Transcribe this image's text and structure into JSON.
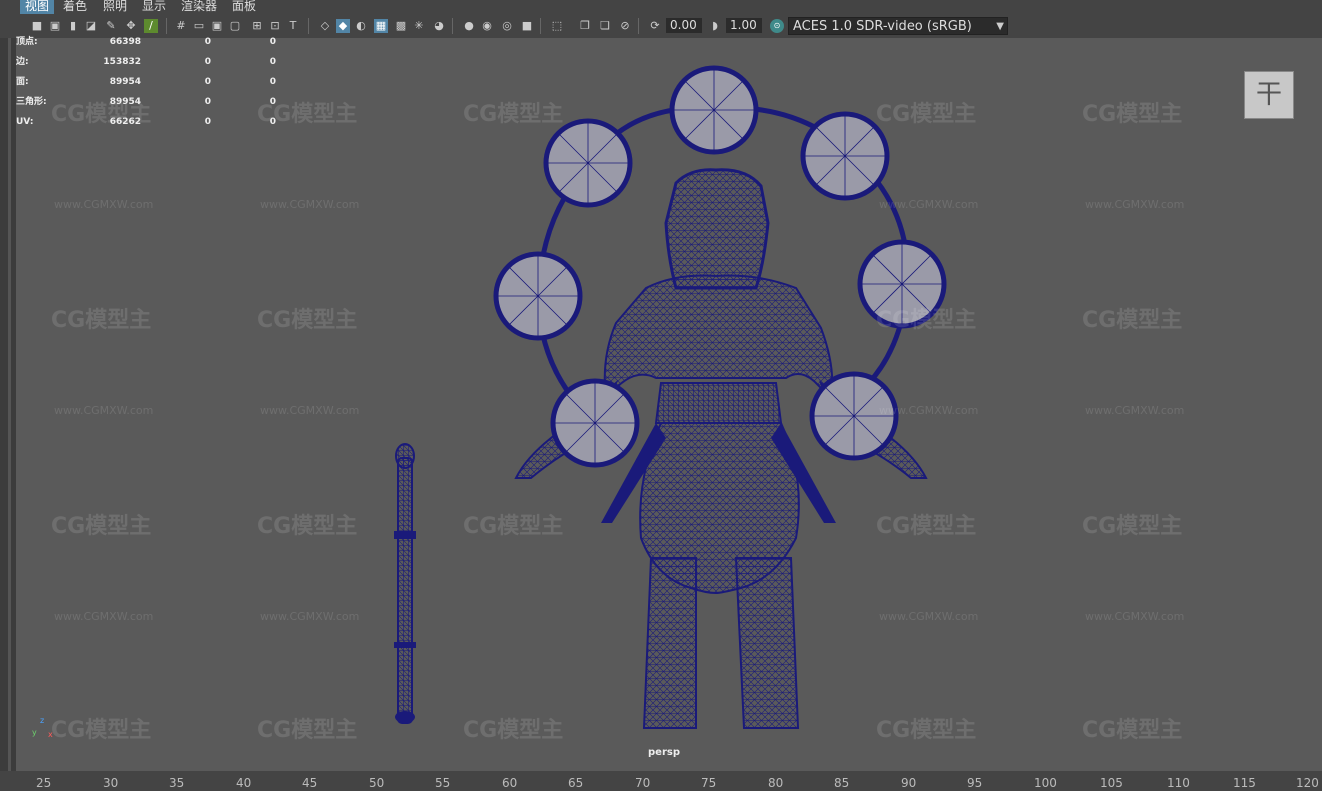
{
  "menu": [
    "视图",
    "着色",
    "照明",
    "显示",
    "渲染器",
    "面板"
  ],
  "toolbar": {
    "exposure_value": "0.00",
    "gamma_value": "1.00",
    "color_space": "ACES 1.0 SDR-video (sRGB)"
  },
  "hud": [
    {
      "label": "顶点:",
      "v1": "66398",
      "v2": "0",
      "v3": "0"
    },
    {
      "label": "边:",
      "v1": "153832",
      "v2": "0",
      "v3": "0"
    },
    {
      "label": "面:",
      "v1": "89954",
      "v2": "0",
      "v3": "0"
    },
    {
      "label": "三角形:",
      "v1": "89954",
      "v2": "0",
      "v3": "0"
    },
    {
      "label": "UV:",
      "v1": "66262",
      "v2": "0",
      "v3": "0"
    }
  ],
  "camera_label": "persp",
  "viewcube_label": "干",
  "ruler": [
    "25",
    "30",
    "35",
    "40",
    "45",
    "50",
    "55",
    "60",
    "65",
    "70",
    "75",
    "80",
    "85",
    "90",
    "95",
    "100",
    "105",
    "110",
    "115",
    "120"
  ],
  "watermark": {
    "brand": "CG模型主",
    "url": "www.CGMXW.com"
  },
  "colors": {
    "wireframe": "#1a1a7a",
    "viewport": "#5a5a5a",
    "accent": "#5285a6"
  },
  "axis": {
    "x": "x",
    "y": "y",
    "z": "z"
  }
}
